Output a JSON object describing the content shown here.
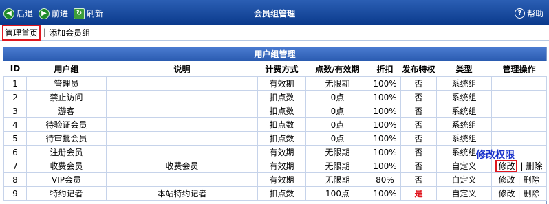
{
  "toolbar": {
    "back": "后退",
    "forward": "前进",
    "refresh": "刷新",
    "title": "会员组管理",
    "help": "帮助"
  },
  "subnav": {
    "home": "管理首页",
    "separator": "|",
    "add": "添加会员组"
  },
  "panel_title": "用户组管理",
  "columns": [
    "ID",
    "用户组",
    "说明",
    "计费方式",
    "点数/有效期",
    "折扣",
    "发布特权",
    "类型",
    "管理操作"
  ],
  "rows": [
    {
      "id": "1",
      "name": "管理员",
      "desc": "",
      "fee": "有效期",
      "pts": "无限期",
      "disc": "100%",
      "pub": "否",
      "type": "系统组",
      "op": ""
    },
    {
      "id": "2",
      "name": "禁止访问",
      "desc": "",
      "fee": "扣点数",
      "pts": "0点",
      "disc": "100%",
      "pub": "否",
      "type": "系统组",
      "op": ""
    },
    {
      "id": "3",
      "name": "游客",
      "desc": "",
      "fee": "扣点数",
      "pts": "0点",
      "disc": "100%",
      "pub": "否",
      "type": "系统组",
      "op": ""
    },
    {
      "id": "4",
      "name": "待验证会员",
      "desc": "",
      "fee": "扣点数",
      "pts": "0点",
      "disc": "100%",
      "pub": "否",
      "type": "系统组",
      "op": ""
    },
    {
      "id": "5",
      "name": "待审批会员",
      "desc": "",
      "fee": "扣点数",
      "pts": "0点",
      "disc": "100%",
      "pub": "否",
      "type": "系统组",
      "op": ""
    },
    {
      "id": "6",
      "name": "注册会员",
      "desc": "",
      "fee": "有效期",
      "pts": "无限期",
      "disc": "100%",
      "pub": "否",
      "type": "系统组",
      "op": ""
    },
    {
      "id": "7",
      "name": "收费会员",
      "desc": "收费会员",
      "fee": "有效期",
      "pts": "无限期",
      "disc": "100%",
      "pub": "否",
      "type": "自定义",
      "op": "edit-delete",
      "edit": "修改",
      "sep": "|",
      "del": "删除"
    },
    {
      "id": "8",
      "name": "VIP会员",
      "desc": "",
      "fee": "有效期",
      "pts": "无限期",
      "disc": "80%",
      "pub": "否",
      "type": "自定义",
      "op": "edit-delete",
      "edit": "修改",
      "sep": "|",
      "del": "删除"
    },
    {
      "id": "9",
      "name": "特约记者",
      "desc": "本站特约记者",
      "fee": "扣点数",
      "pts": "100点",
      "disc": "100%",
      "pub": "是",
      "type": "自定义",
      "op": "edit-delete",
      "edit": "修改",
      "sep": "|",
      "del": "删除"
    }
  ],
  "callout": "修改权限",
  "colors": {
    "accent": "#0b3a8c",
    "highlight": "#e0171f",
    "callout": "#1a33cc"
  }
}
